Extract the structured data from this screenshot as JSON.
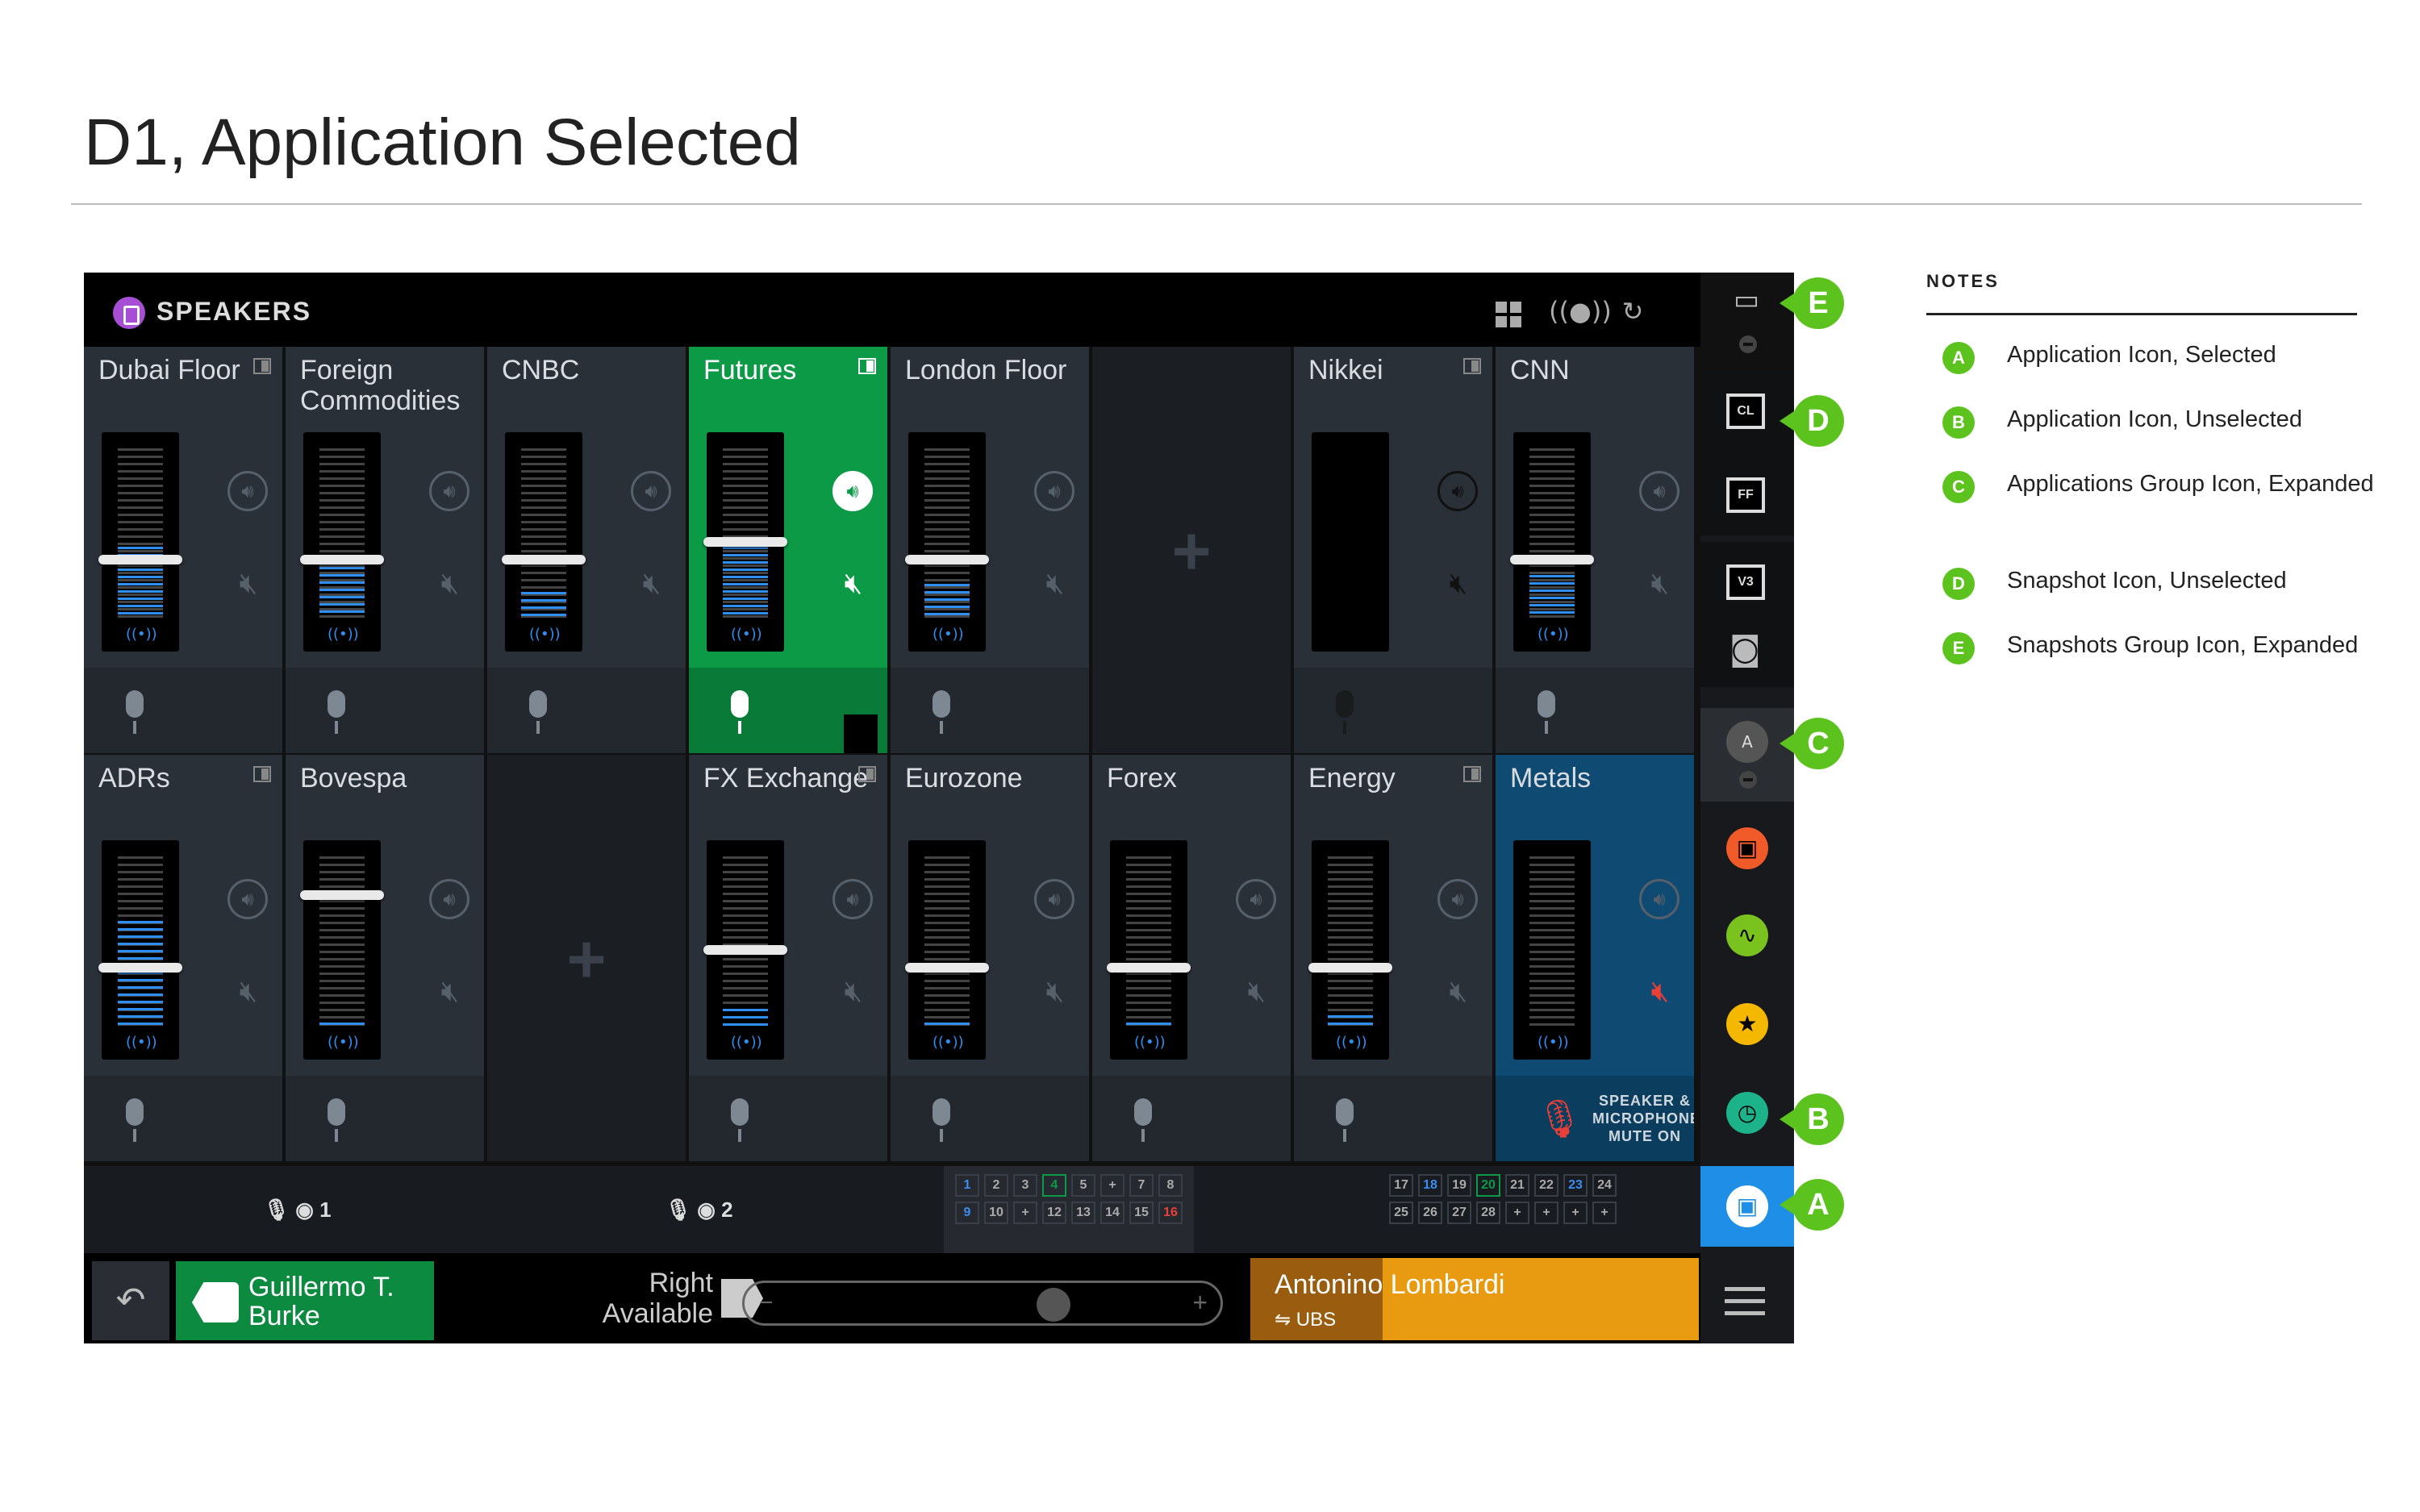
{
  "page_title": "D1, Application Selected",
  "app": {
    "title": "SPEAKERS",
    "tiles": [
      {
        "name": "Dubai Floor",
        "level": 0.42,
        "knob": 0.58,
        "state": "normal",
        "corner": true
      },
      {
        "name": "Foreign Commodities",
        "level": 0.3,
        "knob": 0.58,
        "state": "normal",
        "corner": false
      },
      {
        "name": "CNBC",
        "level": 0.15,
        "knob": 0.58,
        "state": "normal",
        "corner": false
      },
      {
        "name": "Futures",
        "level": 0.46,
        "knob": 0.5,
        "state": "selected",
        "corner": true
      },
      {
        "name": "London Floor",
        "level": 0.2,
        "knob": 0.58,
        "state": "normal",
        "corner": false
      },
      {
        "name": "",
        "state": "empty"
      },
      {
        "name": "Nikkei",
        "state": "dark",
        "corner": true
      },
      {
        "name": "CNN",
        "level": 0.25,
        "knob": 0.58,
        "state": "normal",
        "corner": false
      },
      {
        "name": "ADRs",
        "level": 0.62,
        "knob": 0.58,
        "state": "normal",
        "corner": true
      },
      {
        "name": "Bovespa",
        "level": 0.02,
        "knob": 0.25,
        "state": "normal",
        "corner": false
      },
      {
        "name": "",
        "state": "empty"
      },
      {
        "name": "FX Exchange",
        "level": 0.1,
        "knob": 0.5,
        "state": "normal",
        "corner": true
      },
      {
        "name": "Eurozone",
        "level": 0.02,
        "knob": 0.58,
        "state": "normal",
        "corner": false
      },
      {
        "name": "Forex",
        "level": 0.02,
        "knob": 0.58,
        "state": "normal",
        "corner": false
      },
      {
        "name": "Energy",
        "level": 0.06,
        "knob": 0.58,
        "state": "normal",
        "corner": true
      },
      {
        "name": "Metals",
        "state": "muted",
        "corner": false
      }
    ],
    "mute_label": "SPEAKER & MICROPHONE MUTE ON",
    "strip": {
      "mic1": "1",
      "mic2": "2",
      "grid1": {
        "row1": [
          "1",
          "2",
          "3",
          "4",
          "5",
          "+",
          "7",
          "8"
        ],
        "row2": [
          "9",
          "10",
          "+",
          "12",
          "13",
          "14",
          "15",
          "16"
        ]
      },
      "grid2": {
        "row1": [
          "17",
          "18",
          "19",
          "20",
          "21",
          "22",
          "23",
          "24"
        ],
        "row2": [
          "25",
          "26",
          "27",
          "28",
          "+",
          "+",
          "+",
          "+"
        ]
      }
    },
    "call": {
      "caller": "Guillermo T. Burke",
      "right_line": "Right",
      "right_status": "Available",
      "contact": "Antonino Lombardi",
      "firm": "⇋ UBS"
    },
    "side": {
      "snap1": "CL",
      "snap2": "FF",
      "snap3": "V3"
    },
    "colors": {
      "selected": "#0c9a47",
      "muted_tile": "#0e4a72",
      "app_selected": "#1f8ee6",
      "callout": "#5cc21d",
      "orange": "#e89a10"
    }
  },
  "notes": {
    "heading": "NOTES",
    "items": [
      {
        "key": "A",
        "text": "Application Icon, Selected"
      },
      {
        "key": "B",
        "text": "Application Icon, Unselected"
      },
      {
        "key": "C",
        "text": "Applications Group Icon, Expanded"
      },
      {
        "key": "D",
        "text": "Snapshot Icon, Unselected"
      },
      {
        "key": "E",
        "text": "Snapshots Group Icon, Expanded"
      }
    ]
  }
}
